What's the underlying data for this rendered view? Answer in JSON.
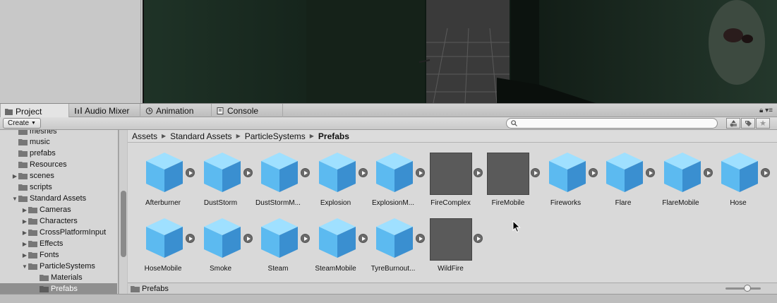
{
  "tabs": [
    {
      "label": "Project",
      "icon": "folder-icon",
      "active": true
    },
    {
      "label": "Audio Mixer",
      "icon": "audio-mixer-icon",
      "active": false
    },
    {
      "label": "Animation",
      "icon": "animation-icon",
      "active": false
    },
    {
      "label": "Console",
      "icon": "console-icon",
      "active": false
    }
  ],
  "toolbar": {
    "create_label": "Create",
    "search_placeholder": "",
    "buttons": [
      "filter-by-type-icon",
      "filter-by-label-icon",
      "favorite-star-icon"
    ]
  },
  "tree": [
    {
      "label": "meshes",
      "expandable": false,
      "selected": false
    },
    {
      "label": "music",
      "expandable": false,
      "selected": false
    },
    {
      "label": "prefabs",
      "expandable": false,
      "selected": false
    },
    {
      "label": "Resources",
      "expandable": false,
      "selected": false
    },
    {
      "label": "scenes",
      "expandable": true,
      "expanded": false,
      "selected": false
    },
    {
      "label": "scripts",
      "expandable": false,
      "selected": false
    },
    {
      "label": "Standard Assets",
      "expandable": true,
      "expanded": true,
      "selected": false
    },
    {
      "label": "Cameras",
      "expandable": true,
      "expanded": false,
      "selected": false
    },
    {
      "label": "Characters",
      "expandable": true,
      "expanded": false,
      "selected": false
    },
    {
      "label": "CrossPlatformInput",
      "expandable": true,
      "expanded": false,
      "selected": false
    },
    {
      "label": "Effects",
      "expandable": true,
      "expanded": false,
      "selected": false
    },
    {
      "label": "Fonts",
      "expandable": true,
      "expanded": false,
      "selected": false
    },
    {
      "label": "ParticleSystems",
      "expandable": true,
      "expanded": true,
      "selected": false
    },
    {
      "label": "Materials",
      "expandable": false,
      "selected": false
    },
    {
      "label": "Prefabs",
      "expandable": false,
      "selected": true
    }
  ],
  "breadcrumb": [
    "Assets",
    "Standard Assets",
    "ParticleSystems",
    "Prefabs"
  ],
  "assets": [
    {
      "label": "Afterburner",
      "kind": "cube"
    },
    {
      "label": "DustStorm",
      "kind": "cube"
    },
    {
      "label": "DustStormM...",
      "kind": "cube"
    },
    {
      "label": "Explosion",
      "kind": "cube"
    },
    {
      "label": "ExplosionM...",
      "kind": "cube"
    },
    {
      "label": "FireComplex",
      "kind": "thumb"
    },
    {
      "label": "FireMobile",
      "kind": "thumb"
    },
    {
      "label": "Fireworks",
      "kind": "cube"
    },
    {
      "label": "Flare",
      "kind": "cube"
    },
    {
      "label": "FlareMobile",
      "kind": "cube"
    },
    {
      "label": "Hose",
      "kind": "cube"
    },
    {
      "label": "HoseMobile",
      "kind": "cube"
    },
    {
      "label": "Smoke",
      "kind": "cube"
    },
    {
      "label": "Steam",
      "kind": "cube"
    },
    {
      "label": "SteamMobile",
      "kind": "cube"
    },
    {
      "label": "TyreBurnout...",
      "kind": "cube"
    },
    {
      "label": "WildFire",
      "kind": "thumb"
    }
  ],
  "footer": {
    "path_label": "Prefabs"
  },
  "colors": {
    "selection": "#8f8f8f",
    "cube_light": "#9fe0ff",
    "cube_mid": "#5cbaf0",
    "cube_dark": "#3a8fd0"
  }
}
